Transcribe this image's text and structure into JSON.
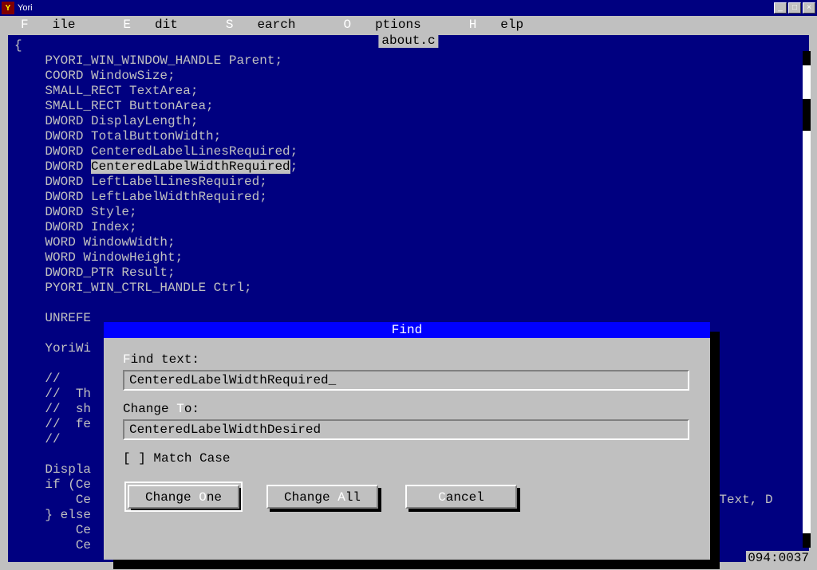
{
  "window": {
    "title": "Yori"
  },
  "titlebar_buttons": {
    "min": "_",
    "max": "□",
    "close": "×"
  },
  "menu": {
    "file": "ile",
    "file_hk": "F",
    "edit": "dit",
    "edit_hk": "E",
    "search": "earch",
    "search_hk": "S",
    "options": "ptions",
    "options_hk": "O",
    "help": "elp",
    "help_hk": "H"
  },
  "file_tab": " about.c ",
  "code": {
    "l1": "{",
    "l2": "    PYORI_WIN_WINDOW_HANDLE Parent;",
    "l3": "    COORD WindowSize;",
    "l4": "    SMALL_RECT TextArea;",
    "l5": "    SMALL_RECT ButtonArea;",
    "l6": "    DWORD DisplayLength;",
    "l7": "    DWORD TotalButtonWidth;",
    "l8": "    DWORD CenteredLabelLinesRequired;",
    "l9a": "    DWORD ",
    "l9b": "CenteredLabelWidthRequired",
    "l9c": ";",
    "l10": "    DWORD LeftLabelLinesRequired;",
    "l11": "    DWORD LeftLabelWidthRequired;",
    "l12": "    DWORD Style;",
    "l13": "    DWORD Index;",
    "l14": "    WORD WindowWidth;",
    "l15": "    WORD WindowHeight;",
    "l16": "    DWORD_PTR Result;",
    "l17": "    PYORI_WIN_CTRL_HANDLE Ctrl;",
    "l18": "",
    "l19": "    UNREFE",
    "l20": "",
    "l21": "    YoriWi",
    "l22": "",
    "l23": "    //",
    "l24": "    //  Th",
    "l25": "    //  sh",
    "l26": "    //  fe",
    "l27": "    //",
    "l28": "",
    "l29": "    Displa",
    "l30": "    if (Ce",
    "l31": "        Ce",
    "l31b": "dText, D",
    "l32": "    } else",
    "l33": "        Ce",
    "l34": "        Ce"
  },
  "status": "094:0037",
  "dialog": {
    "title": "Find",
    "find_label_pre": "",
    "find_label_hk": "F",
    "find_label_post": "ind text:",
    "find_value": "CenteredLabelWidthRequired",
    "change_label_pre": "Change ",
    "change_label_hk": "T",
    "change_label_post": "o:",
    "change_value": "CenteredLabelWidthDesired",
    "match_pre": "[ ] ",
    "match_hk": "M",
    "match_post": "atch Case",
    "btn_change_one_pre": "Change ",
    "btn_change_one_hk": "O",
    "btn_change_one_post": "ne",
    "btn_change_all_pre": "Change ",
    "btn_change_all_hk": "A",
    "btn_change_all_post": "ll",
    "btn_cancel_hk": "C",
    "btn_cancel_post": "ancel"
  }
}
